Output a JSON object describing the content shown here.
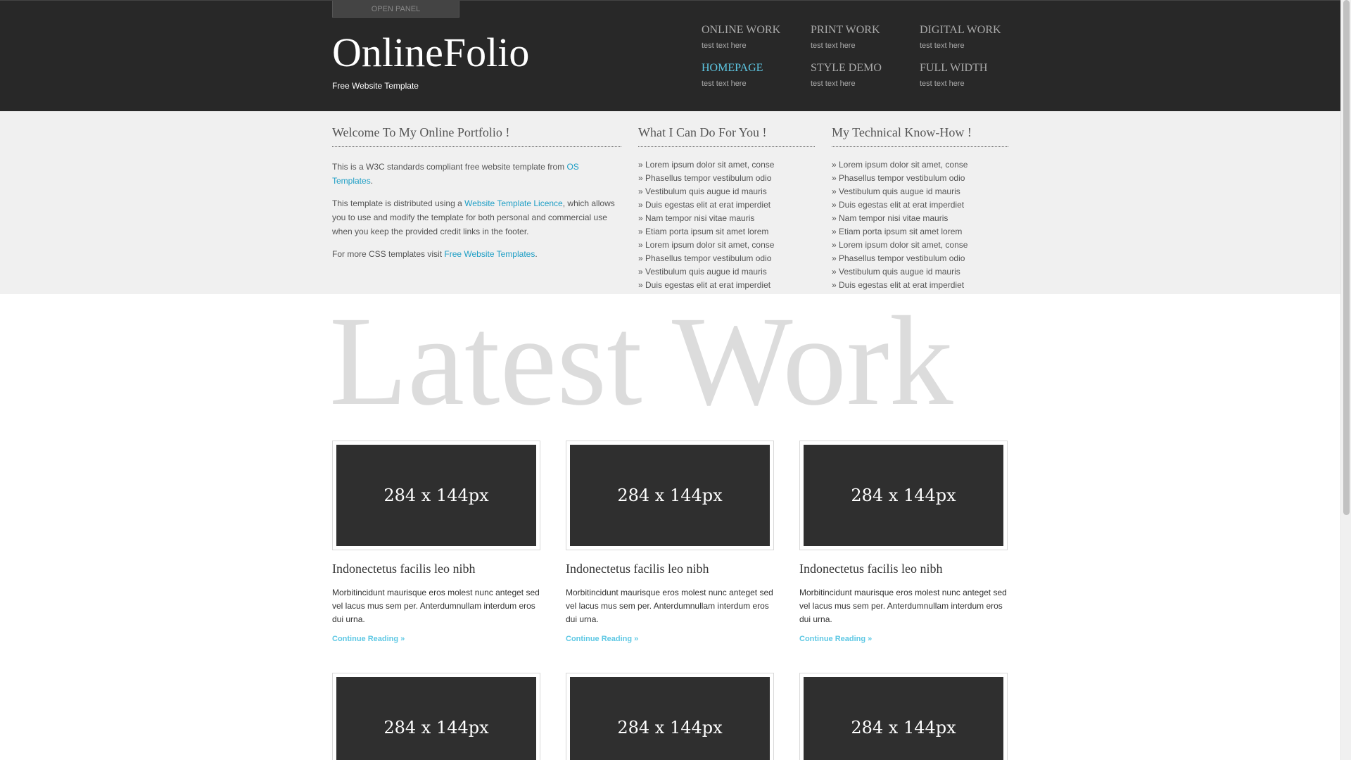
{
  "header": {
    "open_panel": "OPEN PANEL",
    "logo": "OnlineFolio",
    "tagline": "Free Website Template"
  },
  "nav": [
    {
      "title": "ONLINE WORK",
      "sub": "test text here"
    },
    {
      "title": "PRINT WORK",
      "sub": "test text here"
    },
    {
      "title": "DIGITAL WORK",
      "sub": "test text here"
    },
    {
      "title": "HOMEPAGE",
      "sub": "test text here",
      "active": true
    },
    {
      "title": "STYLE DEMO",
      "sub": "test text here"
    },
    {
      "title": "FULL WIDTH",
      "sub": "test text here"
    }
  ],
  "welcome": {
    "heading": "Welcome To My Online Portfolio !",
    "p1_text": "This is a W3C standards compliant free website template from ",
    "p1_link": "OS Templates",
    "p1_end": ".",
    "p2_text": "This template is distributed using a ",
    "p2_link": "Website Template Licence",
    "p2_end": ", which allows you to use and modify the template for both personal and commercial use when you keep the provided credit links in the footer.",
    "p3_text": "For more CSS templates visit ",
    "p3_link": "Free Website Templates",
    "p3_end": "."
  },
  "can_do": {
    "heading": "What I Can Do For You !",
    "items": [
      "» Lorem ipsum dolor sit amet, conse",
      "» Phasellus tempor vestibulum odio",
      "» Vestibulum quis augue id mauris",
      "» Duis egestas elit at erat imperdiet",
      "» Nam tempor nisi vitae mauris",
      "» Etiam porta ipsum sit amet lorem",
      "» Lorem ipsum dolor sit amet, conse",
      "» Phasellus tempor vestibulum odio",
      "» Vestibulum quis augue id mauris",
      "» Duis egestas elit at erat imperdiet"
    ]
  },
  "tech": {
    "heading": "My Technical Know-How !",
    "items": [
      "» Lorem ipsum dolor sit amet, conse",
      "» Phasellus tempor vestibulum odio",
      "» Vestibulum quis augue id mauris",
      "» Duis egestas elit at erat imperdiet",
      "» Nam tempor nisi vitae mauris",
      "» Etiam porta ipsum sit amet lorem",
      "» Lorem ipsum dolor sit amet, conse",
      "» Phasellus tempor vestibulum odio",
      "» Vestibulum quis augue id mauris",
      "» Duis egestas elit at erat imperdiet"
    ]
  },
  "latest": {
    "heading": "Latest Work",
    "cards": [
      {
        "img": "284 x 144px",
        "title": "Indonectetus facilis leo nibh",
        "text": "Morbitincidunt maurisque eros molest nunc anteget sed vel lacus mus sem per. Anterdumnullam interdum eros dui urna.",
        "link": "Continue Reading »"
      },
      {
        "img": "284 x 144px",
        "title": "Indonectetus facilis leo nibh",
        "text": "Morbitincidunt maurisque eros molest nunc anteget sed vel lacus mus sem per. Anterdumnullam interdum eros dui urna.",
        "link": "Continue Reading »"
      },
      {
        "img": "284 x 144px",
        "title": "Indonectetus facilis leo nibh",
        "text": "Morbitincidunt maurisque eros molest nunc anteget sed vel lacus mus sem per. Anterdumnullam interdum eros dui urna.",
        "link": "Continue Reading »"
      },
      {
        "img": "284 x 144px"
      },
      {
        "img": "284 x 144px"
      },
      {
        "img": "284 x 144px"
      }
    ]
  },
  "colors": {
    "header_bg": "#282828",
    "band_bg": "#f0f0f0",
    "accent": "#5ec8e4",
    "link": "#1e9ec5"
  }
}
